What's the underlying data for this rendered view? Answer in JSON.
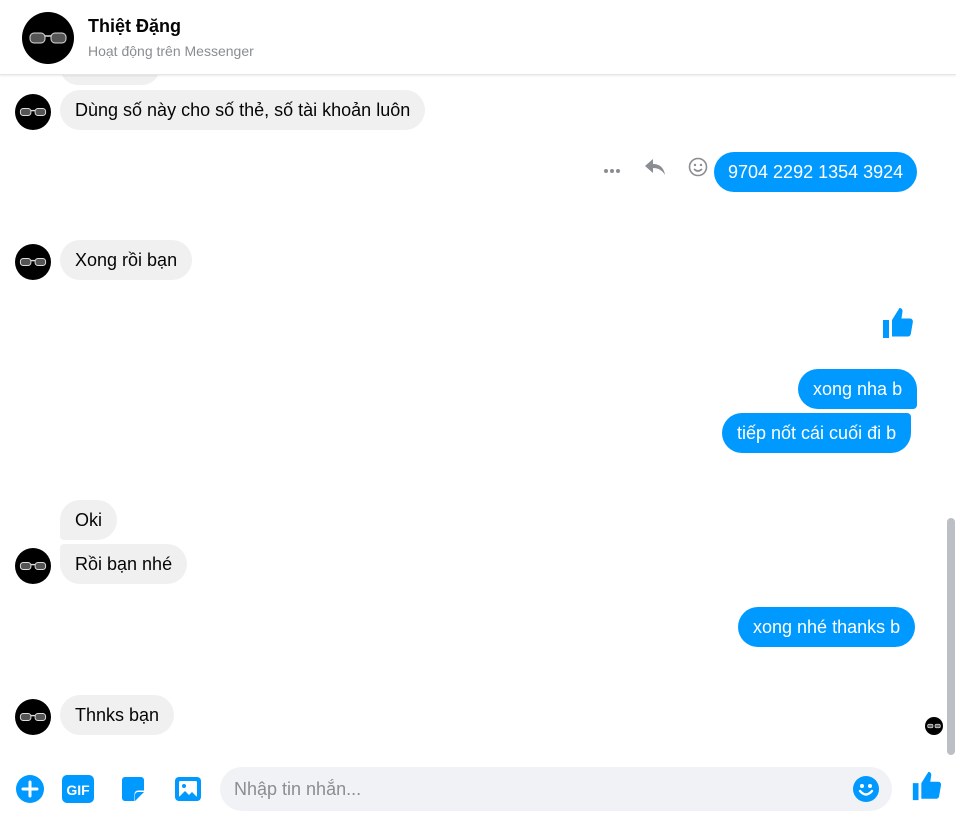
{
  "header": {
    "name": "Thiệt Đặng",
    "status": "Hoạt động trên Messenger"
  },
  "messages": [
    {
      "direction": "in",
      "text": "Dùng số này cho số thẻ, số tài khoản luôn"
    },
    {
      "direction": "out",
      "text": "9704 2292 1354 3924"
    },
    {
      "direction": "in",
      "text": "Xong rồi bạn"
    },
    {
      "direction": "out",
      "type": "like-sticker"
    },
    {
      "direction": "out",
      "text": "xong nha b"
    },
    {
      "direction": "out",
      "text": "tiếp nốt cái cuối đi b"
    },
    {
      "direction": "in",
      "text": "Oki"
    },
    {
      "direction": "in",
      "text": "Rồi bạn nhé"
    },
    {
      "direction": "out",
      "text": "xong nhé thanks b"
    },
    {
      "direction": "in",
      "text": "Thnks bạn"
    }
  ],
  "hover_actions": [
    "more-icon",
    "reply-icon",
    "react-icon"
  ],
  "composer": {
    "placeholder": "Nhập tin nhắn...",
    "tools": [
      "plus-icon",
      "gif-icon",
      "sticker-icon",
      "image-icon"
    ],
    "gif_label": "GIF"
  },
  "colors": {
    "accent": "#0099ff",
    "incoming_bubble": "#f0f0f0",
    "outgoing_text": "#ffffff"
  }
}
